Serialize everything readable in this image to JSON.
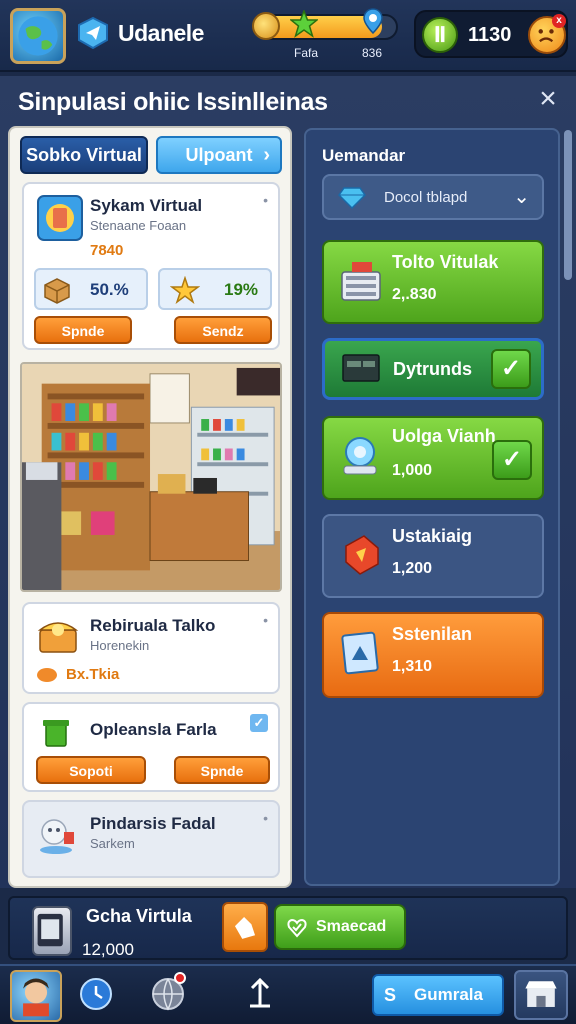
{
  "header": {
    "app_name": "Udanele",
    "xp_label": "Fafa",
    "xp_value": "836",
    "xp_progress": 0.9,
    "gem_count": "1130",
    "face_badge": "x"
  },
  "modal": {
    "title": "Sinpulasi ohiic Issinlleinas",
    "close_symbol": "×"
  },
  "left": {
    "tabs": [
      {
        "label": "Sobko Virtual",
        "active": true
      },
      {
        "label": "Ulpoant",
        "active": false,
        "chevron": "›"
      }
    ],
    "card_a": {
      "title": "Sykam Virtual",
      "subtitle": "Stenaane Foaan",
      "price": "7840",
      "stat_1": "50.%",
      "stat_2": "19%",
      "button_1": "Spnde",
      "button_2": "Sendz",
      "kebab": "•"
    },
    "card_b": {
      "title": "Rebiruala Talko",
      "subtitle": "Horenekin",
      "tag": "Bx.Tkia",
      "kebab": "•"
    },
    "card_c": {
      "title": "Opleansla Farla",
      "button_1": "Sopoti",
      "button_2": "Spnde",
      "check": "✓"
    },
    "card_d": {
      "title": "Pindarsis Fadal",
      "subtitle": "Sarkem",
      "kebab": "•"
    }
  },
  "right": {
    "heading": "Uemandar",
    "select_value": "Docol tblapd",
    "select_chevron": "⌄",
    "items": [
      {
        "title": "Tolto Vitulak",
        "price": "2,.830",
        "style": "green",
        "checked": false
      },
      {
        "title": "Dytrunds",
        "price": "",
        "style": "teal",
        "checked": true
      },
      {
        "title": "Uolga Vianh",
        "price": "1,000",
        "style": "green",
        "checked": true
      },
      {
        "title": "Ustakiaig",
        "price": "1,200",
        "style": "gray",
        "checked": false
      },
      {
        "title": "Sstenilan",
        "price": "1,310",
        "style": "orange",
        "checked": false
      }
    ],
    "check_symbol": "✓"
  },
  "purchase": {
    "name": "Gcha Virtula",
    "price": "12,000",
    "confirm_label": "Smaecad"
  },
  "nav": {
    "primary_label": "Gumrala",
    "primary_icon_text": "S"
  },
  "colors": {
    "accent_orange": "#e8700e",
    "accent_green": "#4ea41c",
    "accent_blue": "#2690e0",
    "panel_bg": "#2b4472"
  }
}
